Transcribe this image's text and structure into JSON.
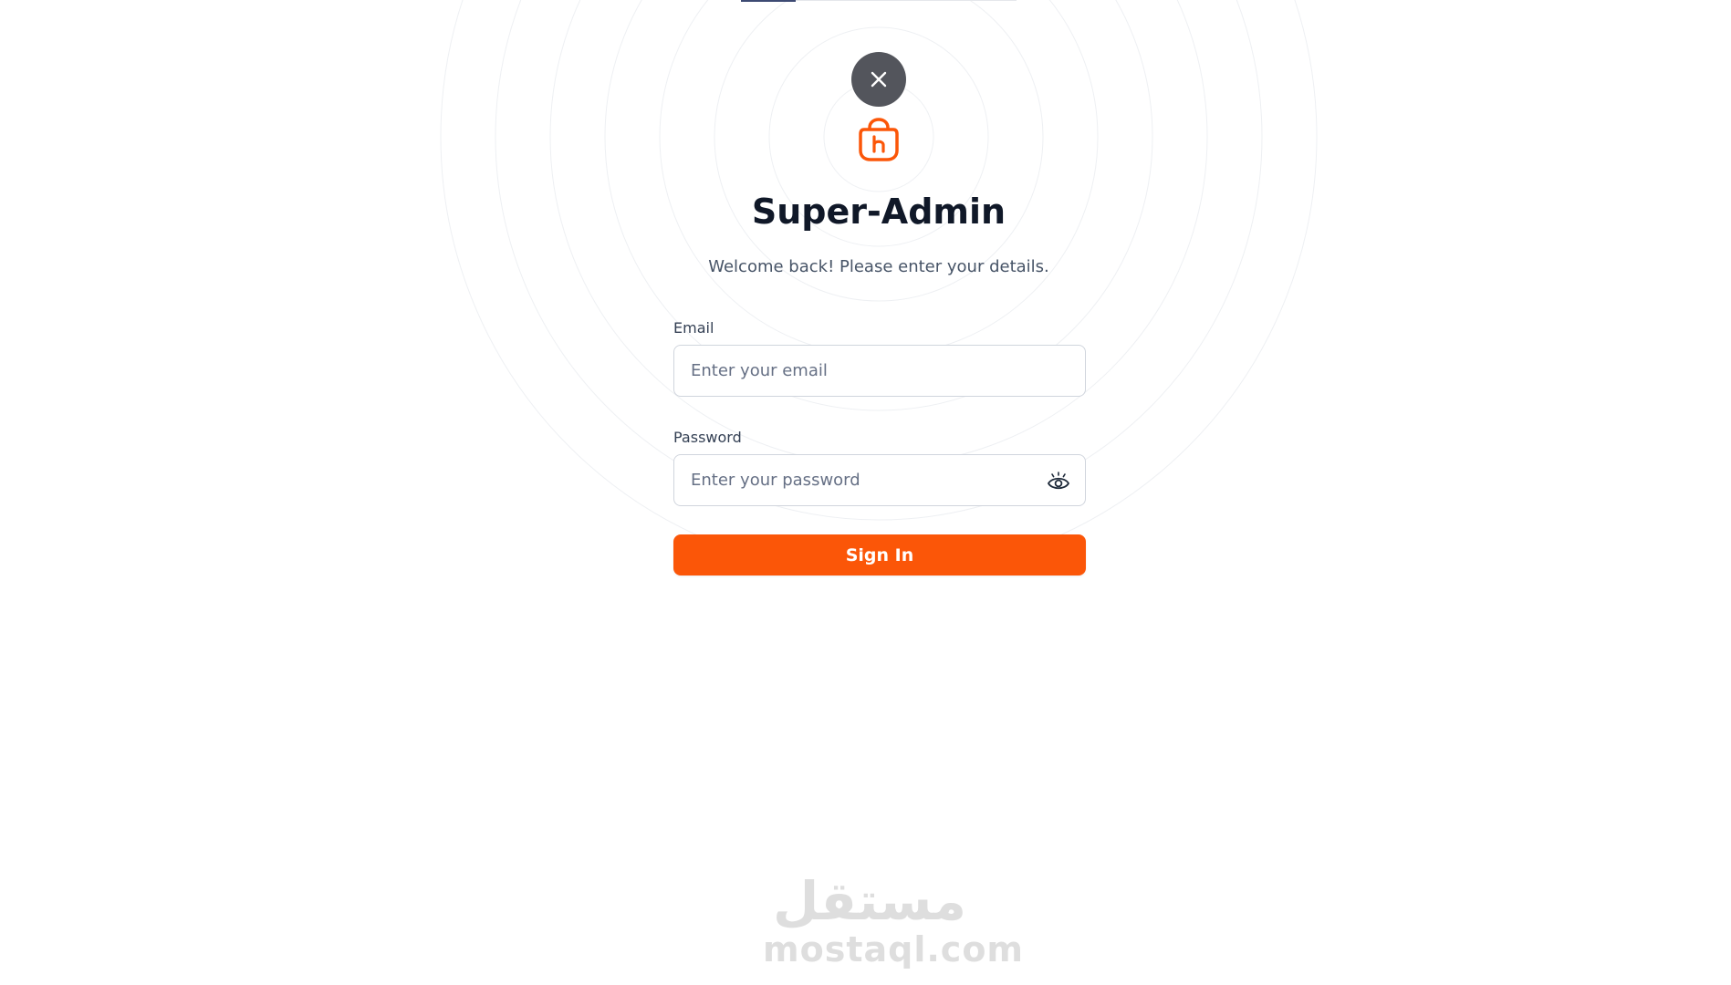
{
  "brand": {
    "title": "Super-Admin",
    "subtitle": "Welcome back! Please enter your details.",
    "logo_icon": "shopping-bag-h-icon",
    "accent_color": "#fb5608"
  },
  "header": {
    "close_icon": "close-icon"
  },
  "form": {
    "email": {
      "label": "Email",
      "placeholder": "Enter your email",
      "value": ""
    },
    "password": {
      "label": "Password",
      "placeholder": "Enter your password",
      "value": "",
      "toggle_icon": "eye-icon"
    },
    "submit_label": "Sign In"
  },
  "watermark": {
    "arabic": "مستقل",
    "latin": "mostaql.com"
  }
}
